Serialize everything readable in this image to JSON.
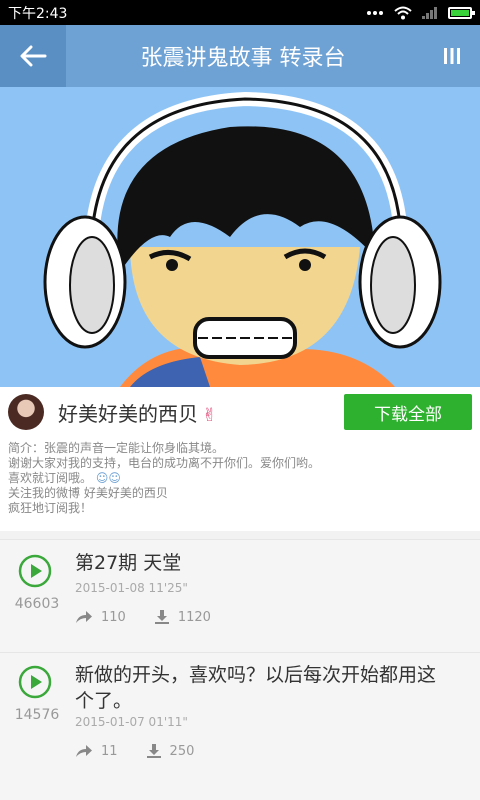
{
  "status_bar": {
    "time": "下午2:43"
  },
  "header": {
    "title": "张震讲鬼故事 转录台"
  },
  "author": {
    "name": "好美好美的西贝",
    "download_all_label": "下载全部"
  },
  "description": {
    "lines": [
      "简介：张震的声音一定能让你身临其境。",
      "谢谢大家对我的支持，电台的成功离不开你们。爱你们哟。",
      "喜欢就订阅哦。",
      "关注我的微博 好美好美的西贝",
      "疯狂地订阅我！"
    ]
  },
  "episodes": [
    {
      "title": "第27期  天堂",
      "plays": "46603",
      "date": "2015-01-08  11'25\"",
      "shares": "110",
      "downloads": "1120"
    },
    {
      "title": "新做的开头，喜欢吗？以后每次开始都用这个了。",
      "plays": "14576",
      "date": "2015-01-07  01'11\"",
      "shares": "11",
      "downloads": "250"
    }
  ],
  "colors": {
    "header_bg": "#6ea1d4",
    "accent_green": "#2eb12e",
    "play_green": "#3aa83a"
  },
  "icons": {
    "back": "arrow-left-icon",
    "menu": "vertical-bars-icon",
    "play": "play-circle-icon",
    "share": "share-arrow-icon",
    "download": "download-icon"
  }
}
